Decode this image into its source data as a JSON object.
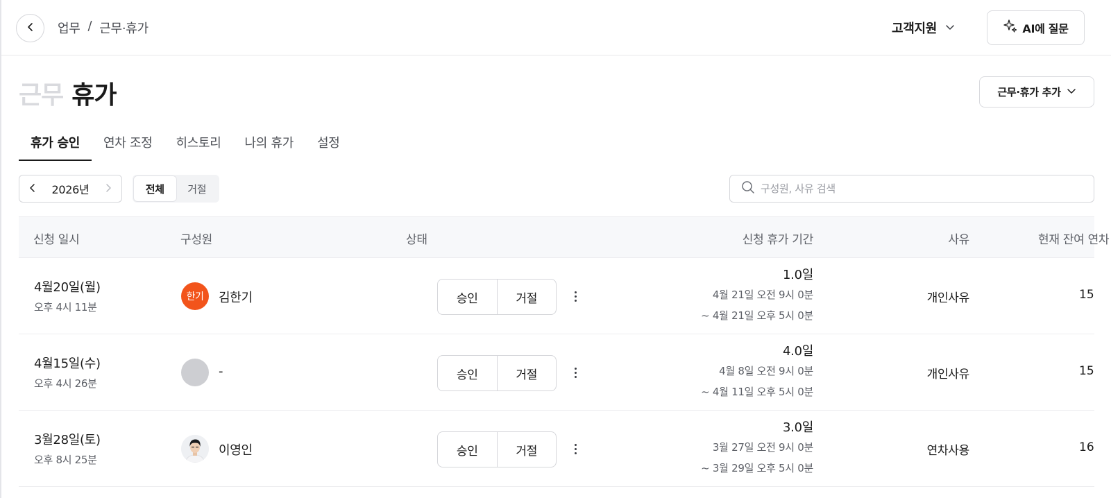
{
  "header": {
    "breadcrumb": [
      "업무",
      "/",
      "근무·휴가"
    ],
    "org_name": "고객지원",
    "ai_button": "AI에 질문"
  },
  "page": {
    "title_muted": "근무",
    "title_active": "휴가",
    "add_button": "근무·휴가 추가"
  },
  "tabs": [
    "휴가 승인",
    "연차 조정",
    "히스토리",
    "나의 휴가",
    "설정"
  ],
  "active_tab": "휴가 승인",
  "filters": {
    "year": "2026년",
    "segments": [
      "전체",
      "거절"
    ],
    "active_segment": "전체",
    "search_placeholder": "구성원, 사유 검색"
  },
  "table": {
    "columns": [
      "신청 일시",
      "구성원",
      "상태",
      "신청 휴가 기간",
      "사유",
      "현재 잔여 연차"
    ],
    "rows": [
      {
        "date": "4월20일(월)",
        "time": "오후 4시 11분",
        "avatar_text": "한기",
        "avatar_type": "orange",
        "name": "김한기",
        "approve": "승인",
        "reject": "거절",
        "days": "1.0일",
        "start": "4월 21일 오전 9시 0분",
        "end": "~ 4월 21일 오후 5시 0분",
        "reason": "개인사유",
        "remaining": "15"
      },
      {
        "date": "4월15일(수)",
        "time": "오후 4시 26분",
        "avatar_text": "",
        "avatar_type": "gray",
        "name": "-",
        "approve": "승인",
        "reject": "거절",
        "days": "4.0일",
        "start": "4월 8일 오전 9시 0분",
        "end": "~ 4월 11일 오후 5시 0분",
        "reason": "개인사유",
        "remaining": "15"
      },
      {
        "date": "3월28일(토)",
        "time": "오후 8시 25분",
        "avatar_text": "",
        "avatar_type": "photo",
        "name": "이영인",
        "approve": "승인",
        "reject": "거절",
        "days": "3.0일",
        "start": "3월 27일 오전 9시 0분",
        "end": "~ 3월 29일 오후 5시 0분",
        "reason": "연차사용",
        "remaining": "16"
      }
    ]
  },
  "colors": {
    "accent_orange": "#f2541b",
    "text_primary": "#1a1a1a",
    "text_secondary": "#5c5f66",
    "border": "#d5d6da"
  }
}
